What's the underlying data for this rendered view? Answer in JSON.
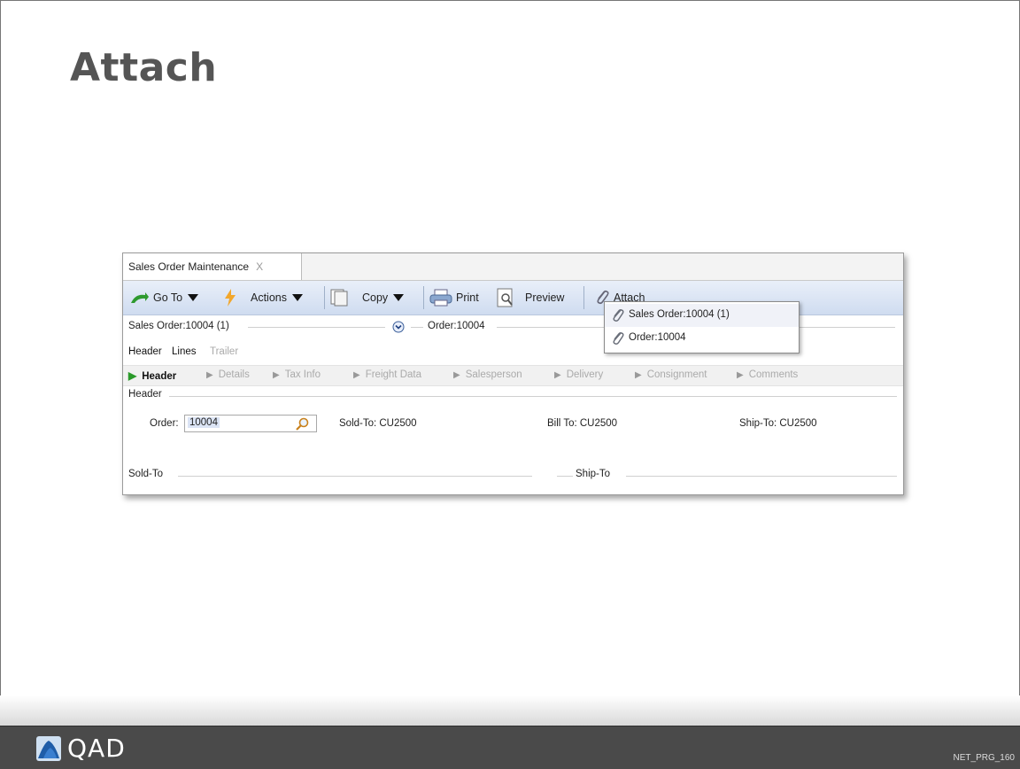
{
  "slide": {
    "title": "Attach",
    "footer_logo_text": "QAD",
    "slide_code": "NET_PRG_160"
  },
  "window": {
    "tab_label": "Sales Order Maintenance",
    "tab_close": "X",
    "toolbar": {
      "goto_label": "Go To",
      "actions_label": "Actions",
      "copy_label": "Copy",
      "print_label": "Print",
      "preview_label": "Preview",
      "attach_label": "Attach"
    },
    "info_row": {
      "sales_order": "Sales Order:10004 (1)",
      "order": "Order:10004"
    },
    "nav_tabs": [
      "Header",
      "Lines",
      "Trailer"
    ],
    "steps": [
      "Header",
      "Details",
      "Tax Info",
      "Freight Data",
      "Salesperson",
      "Delivery",
      "Consignment",
      "Comments"
    ],
    "section_label": "Header",
    "fields": {
      "order_label": "Order:",
      "order_value": "10004",
      "sold_to": "Sold-To:  CU2500",
      "bill_to": "Bill To:  CU2500",
      "ship_to": "Ship-To:  CU2500"
    },
    "sections": {
      "sold_to": "Sold-To",
      "ship_to": "Ship-To"
    }
  },
  "attach_menu": {
    "items": [
      {
        "label": "Sales Order:10004 (1)"
      },
      {
        "label": "Order:10004"
      }
    ]
  },
  "colors": {
    "toolbar_top": "#e9eff9",
    "toolbar_bottom": "#cfdcf0",
    "footer": "#4a4a4a",
    "title": "#555555"
  }
}
